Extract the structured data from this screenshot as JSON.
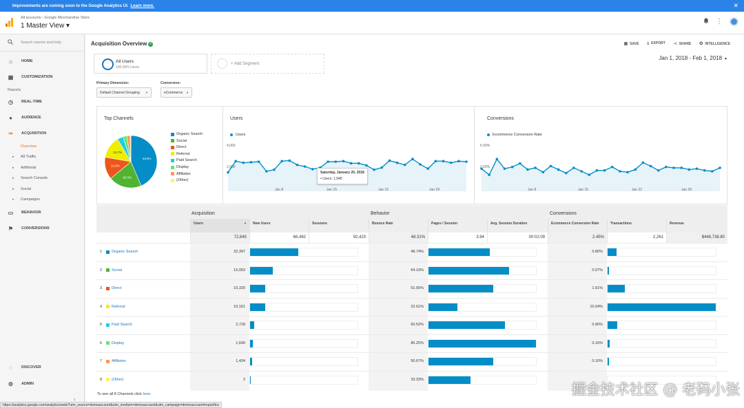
{
  "banner": {
    "text": "Improvements are coming soon to the Google Analytics UI.",
    "link": "Learn more.",
    "close": "✕"
  },
  "appbar": {
    "breadcrumb": "All accounts › Google Merchandise Store",
    "view": "1 Master View ▾"
  },
  "sidebar": {
    "search_placeholder": "Search reports and help",
    "home": "HOME",
    "customization": "CUSTOMIZATION",
    "reports_label": "Reports",
    "realtime": "REAL-TIME",
    "audience": "AUDIENCE",
    "acquisition": "ACQUISITION",
    "acq_items": [
      "Overview",
      "All Traffic",
      "AdWords",
      "Search Console",
      "Social",
      "Campaigns"
    ],
    "behavior": "BEHAVIOR",
    "conversions": "CONVERSIONS",
    "discover": "DISCOVER",
    "admin": "ADMIN",
    "collapse": "‹"
  },
  "page": {
    "title": "Acquisition Overview",
    "toolbar": {
      "save": "SAVE",
      "export": "EXPORT",
      "share": "SHARE",
      "intelligence": "INTELLIGENCE"
    },
    "segment_all": {
      "name": "All Users",
      "pct": "100.00% Users"
    },
    "segment_add": "+ Add Segment",
    "daterange": "Jan 1, 2018 - Feb 1, 2018",
    "primary_dimension_label": "Primary Dimension:",
    "primary_dimension_value": "Default Channel Grouping",
    "conversion_label": "Conversion:",
    "conversion_value": "eCommerce"
  },
  "top_channels": {
    "title": "Top Channels",
    "legend": [
      {
        "name": "Organic Search",
        "color": "#058dc7"
      },
      {
        "name": "Social",
        "color": "#50b432"
      },
      {
        "name": "Direct",
        "color": "#ed561b"
      },
      {
        "name": "Referral",
        "color": "#edef00"
      },
      {
        "name": "Paid Search",
        "color": "#24cbe5"
      },
      {
        "name": "Display",
        "color": "#64e572"
      },
      {
        "name": "Affiliates",
        "color": "#ff9655"
      },
      {
        "name": "(Other)",
        "color": "#fff263"
      }
    ],
    "slice_labels": [
      "43.6%",
      "20.3%",
      "13.9%",
      "13.7%"
    ]
  },
  "users_chart": {
    "title": "Users",
    "series": "Users",
    "y_labels": [
      "4,000",
      "2,000"
    ],
    "x_labels": [
      "Jan 8",
      "Jan 15",
      "Jan 22",
      "Jan 29"
    ],
    "tooltip_date": "Saturday, January 20, 2018",
    "tooltip_value": "• Users: 1,948"
  },
  "conv_chart": {
    "title": "Conversions",
    "series": "Ecommerce Conversion Rate",
    "y_labels": [
      "5.00%",
      "2.50%"
    ],
    "x_labels": [
      "Jan 8",
      "Jan 15",
      "Jan 22",
      "Jan 29"
    ]
  },
  "chart_data": [
    {
      "type": "pie",
      "title": "Top Channels",
      "categories": [
        "Organic Search",
        "Social",
        "Direct",
        "Referral",
        "Paid Search",
        "Display",
        "Affiliates",
        "(Other)"
      ],
      "values": [
        43.6,
        20.3,
        13.9,
        13.7,
        3.7,
        2.3,
        2.0,
        0.5
      ]
    },
    {
      "type": "area",
      "title": "Users",
      "x": [
        "Jan 1",
        "Jan 2",
        "Jan 3",
        "Jan 4",
        "Jan 5",
        "Jan 6",
        "Jan 7",
        "Jan 8",
        "Jan 9",
        "Jan 10",
        "Jan 11",
        "Jan 12",
        "Jan 13",
        "Jan 14",
        "Jan 15",
        "Jan 16",
        "Jan 17",
        "Jan 18",
        "Jan 19",
        "Jan 20",
        "Jan 21",
        "Jan 22",
        "Jan 23",
        "Jan 24",
        "Jan 25",
        "Jan 26",
        "Jan 27",
        "Jan 28",
        "Jan 29",
        "Jan 30",
        "Jan 31",
        "Feb 1"
      ],
      "series": [
        {
          "name": "Users",
          "values": [
            1700,
            2750,
            2600,
            2650,
            2700,
            1800,
            1950,
            2750,
            2800,
            2400,
            2250,
            2000,
            2150,
            2700,
            2700,
            2750,
            2550,
            2550,
            2350,
            1948,
            2150,
            2800,
            2600,
            2400,
            2950,
            2450,
            2050,
            2750,
            2750,
            2600,
            2750,
            2700
          ]
        }
      ],
      "ylim": [
        0,
        4500
      ]
    },
    {
      "type": "area",
      "title": "Conversions",
      "x": [
        "Jan 1",
        "Jan 2",
        "Jan 3",
        "Jan 4",
        "Jan 5",
        "Jan 6",
        "Jan 7",
        "Jan 8",
        "Jan 9",
        "Jan 10",
        "Jan 11",
        "Jan 12",
        "Jan 13",
        "Jan 14",
        "Jan 15",
        "Jan 16",
        "Jan 17",
        "Jan 18",
        "Jan 19",
        "Jan 20",
        "Jan 21",
        "Jan 22",
        "Jan 23",
        "Jan 24",
        "Jan 25",
        "Jan 26",
        "Jan 27",
        "Jan 28",
        "Jan 29",
        "Jan 30",
        "Jan 31",
        "Feb 1"
      ],
      "series": [
        {
          "name": "Ecommerce Conversion Rate",
          "values": [
            2.5,
            1.8,
            3.6,
            2.5,
            2.7,
            3.1,
            2.4,
            2.6,
            2.1,
            2.8,
            2.4,
            2.0,
            2.6,
            2.2,
            1.8,
            2.3,
            2.3,
            2.7,
            2.2,
            2.1,
            2.4,
            3.2,
            2.8,
            2.3,
            2.7,
            2.6,
            2.6,
            2.4,
            2.5,
            2.3,
            2.2,
            2.6
          ]
        }
      ],
      "ylim": [
        0,
        5.5
      ]
    }
  ],
  "table": {
    "groups": {
      "acquisition": "Acquisition",
      "behavior": "Behavior",
      "conversions": "Conversions"
    },
    "headers": [
      "Users",
      "New Users",
      "Sessions",
      "Bounce Rate",
      "Pages / Session",
      "Avg. Session Duration",
      "Ecommerce Conversion Rate",
      "Transactions",
      "Revenue"
    ],
    "totals": [
      "72,845",
      "66,482",
      "92,423",
      "48.31%",
      "3.94",
      "00:02:09",
      "2.45%",
      "2,261",
      "$448,738.80"
    ],
    "rows": [
      {
        "num": "1",
        "name": "Organic Search",
        "color": "#058dc7",
        "users": "32,397",
        "new_users_bar": 0.45,
        "bounce": "48.74%",
        "pages_bar": 0.57,
        "conv": "0.80%",
        "trans_bar": 0.08
      },
      {
        "num": "2",
        "name": "Social",
        "color": "#50b432",
        "users": "15,053",
        "new_users_bar": 0.21,
        "bounce": "64.19%",
        "pages_bar": 0.75,
        "conv": "0.07%",
        "trans_bar": 0.01
      },
      {
        "num": "3",
        "name": "Direct",
        "color": "#ed561b",
        "users": "10,329",
        "new_users_bar": 0.14,
        "bounce": "51.56%",
        "pages_bar": 0.6,
        "conv": "1.61%",
        "trans_bar": 0.16
      },
      {
        "num": "4",
        "name": "Referral",
        "color": "#edef00",
        "users": "10,161",
        "new_users_bar": 0.14,
        "bounce": "22.61%",
        "pages_bar": 0.27,
        "conv": "10.04%",
        "trans_bar": 1.0
      },
      {
        "num": "5",
        "name": "Paid Search",
        "color": "#24cbe5",
        "users": "2,728",
        "new_users_bar": 0.04,
        "bounce": "60.52%",
        "pages_bar": 0.71,
        "conv": "0.90%",
        "trans_bar": 0.09
      },
      {
        "num": "6",
        "name": "Display",
        "color": "#64e572",
        "users": "1,696",
        "new_users_bar": 0.025,
        "bounce": "85.25%",
        "pages_bar": 1.0,
        "conv": "0.16%",
        "trans_bar": 0.016
      },
      {
        "num": "7",
        "name": "Affiliates",
        "color": "#ff9655",
        "users": "1,434",
        "new_users_bar": 0.02,
        "bounce": "50.67%",
        "pages_bar": 0.6,
        "conv": "0.10%",
        "trans_bar": 0.01
      },
      {
        "num": "8",
        "name": "(Other)",
        "color": "#fff263",
        "users": "2",
        "new_users_bar": 0.002,
        "bounce": "33.33%",
        "pages_bar": 0.39,
        "conv": "",
        "trans_bar": 0
      }
    ],
    "see_all": "To see all 8 Channels click",
    "see_all_link": "here."
  },
  "statusbar": "https://analytics.google.com/analytics/web/?utm_source=demoaccount&utm_medium=demoaccount&utm_campaign=demoaccount#report/tra",
  "watermark": "掘金技术社区 @ 老码小张"
}
